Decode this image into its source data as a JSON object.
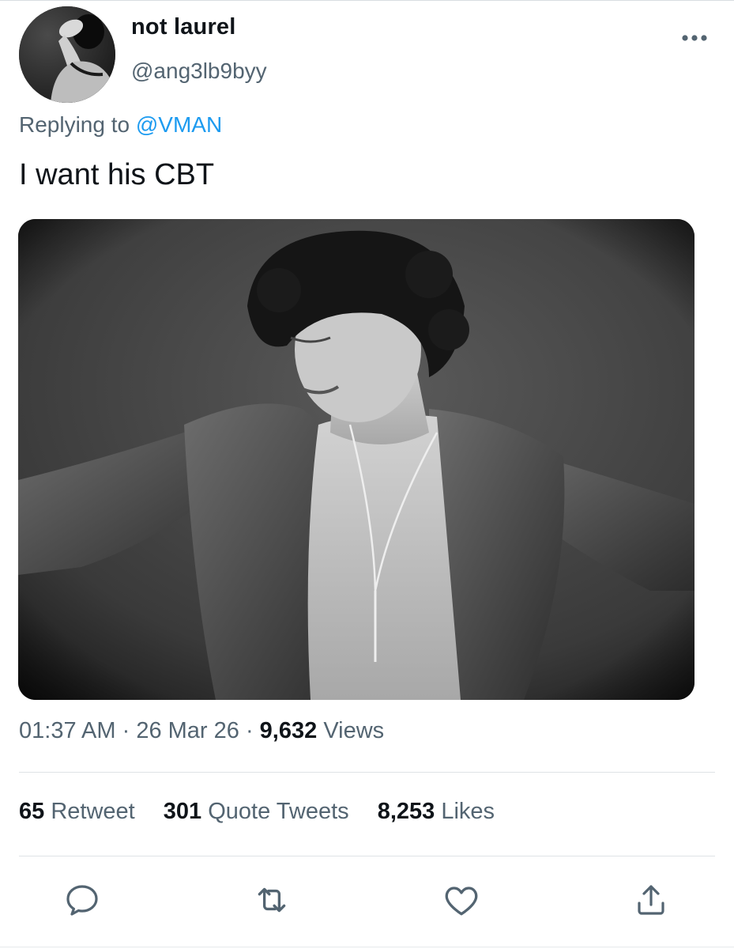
{
  "tweet": {
    "display_name": "not laurel",
    "handle": "@ang3lb9byy",
    "replying_prefix": "Replying to ",
    "replying_to": "@VMAN",
    "text": "I want his CBT",
    "time": "01:37 AM",
    "date": "26 Mar 26",
    "separator": " · ",
    "views_count": "9,632",
    "views_label": "Views"
  },
  "stats": {
    "retweets_count": "65",
    "retweets_label": "Retweet",
    "quotes_count": "301",
    "quotes_label": "Quote Tweets",
    "likes_count": "8,253",
    "likes_label": "Likes"
  },
  "icons": {
    "more": "more-horizontal-icon",
    "reply": "reply-icon",
    "retweet": "retweet-icon",
    "like": "heart-icon",
    "share": "share-icon"
  },
  "colors": {
    "link": "#1d9bf0",
    "secondary_text": "#536471",
    "primary_text": "#0f1419",
    "icon": "#536471"
  }
}
